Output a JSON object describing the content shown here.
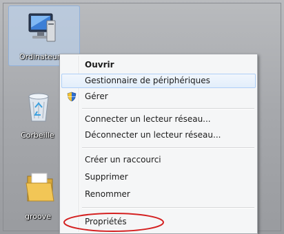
{
  "desktop": {
    "icons": [
      {
        "label": "Ordinateur"
      },
      {
        "label": "Corbeille"
      },
      {
        "label": "groove"
      }
    ]
  },
  "context_menu": {
    "items": [
      {
        "label": "Ouvrir"
      },
      {
        "label": "Gestionnaire de périphériques"
      },
      {
        "label": "Gérer"
      },
      {
        "label": "Connecter un lecteur réseau..."
      },
      {
        "label": "Déconnecter un lecteur réseau..."
      },
      {
        "label": "Créer un raccourci"
      },
      {
        "label": "Supprimer"
      },
      {
        "label": "Renommer"
      },
      {
        "label": "Propriétés"
      }
    ]
  },
  "annotation": {
    "color": "#d42020"
  },
  "icons": {
    "computer": "computer-icon",
    "recycle_bin": "recycle-bin-icon",
    "folder": "folder-icon",
    "shield": "uac-shield-icon"
  }
}
